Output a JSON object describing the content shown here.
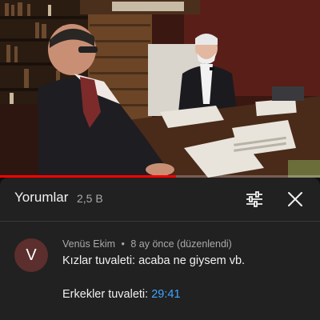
{
  "video": {
    "scene": "two-men-conversation-study",
    "progress": 0.55,
    "progress_color": "#ff0000"
  },
  "comments_panel": {
    "title": "Yorumlar",
    "count": "2,5 B",
    "filter_icon": "sliders-icon",
    "close_icon": "close-icon"
  },
  "comment": {
    "avatar_letter": "V",
    "avatar_color": "#5c2e2e",
    "author": "Venüs Ekim",
    "separator": "•",
    "time_ago": "8 ay önce (düzenlendi)",
    "line1": "Kızlar tuvaleti: acaba ne giysem vb.",
    "line2_prefix": "Erkekler tuvaleti:",
    "line2_timestamp": "29:41"
  },
  "colors": {
    "background": "#0f0f0f",
    "sheet": "#212121",
    "link": "#3ea6ff"
  }
}
